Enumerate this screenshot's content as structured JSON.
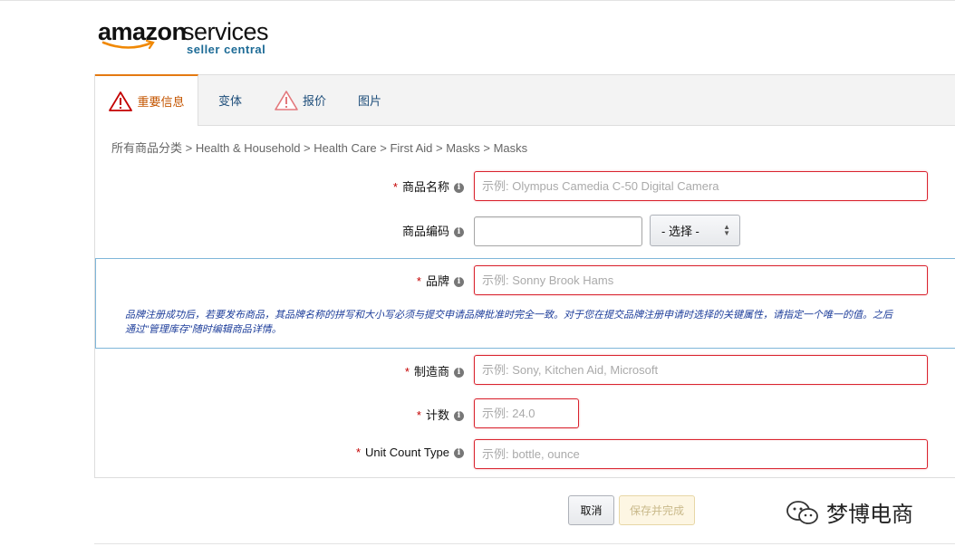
{
  "logo": {
    "amazon": "amazon",
    "services": "services",
    "sub": "seller central"
  },
  "tabs": [
    {
      "label": "重要信息",
      "warning": true,
      "active": true
    },
    {
      "label": "变体",
      "warning": false,
      "active": false
    },
    {
      "label": "报价",
      "warning": true,
      "active": false
    },
    {
      "label": "图片",
      "warning": false,
      "active": false
    }
  ],
  "breadcrumb": "所有商品分类 > Health & Household > Health Care > First Aid > Masks > Masks",
  "fields": {
    "product_name": {
      "label": "商品名称",
      "required": true,
      "placeholder": "示例: Olympus Camedia C-50 Digital Camera"
    },
    "product_id": {
      "label": "商品编码",
      "required": false,
      "placeholder": "",
      "select_label": "- 选择 -"
    },
    "brand": {
      "label": "品牌",
      "required": true,
      "placeholder": "示例: Sonny Brook Hams"
    },
    "manufacturer": {
      "label": "制造商",
      "required": true,
      "placeholder": "示例: Sony, Kitchen Aid, Microsoft"
    },
    "count": {
      "label": "计数",
      "required": true,
      "placeholder": "示例: 24.0"
    },
    "unit_count_type": {
      "label": "Unit Count Type",
      "required": true,
      "placeholder": "示例: bottle, ounce"
    }
  },
  "brand_note": {
    "line1": "品牌注册成功后，若要发布商品，其品牌名称的拼写和大小写必须与提交申请品牌批准时完全一致。对于您在提交品牌注册申请时选择的关键属性，请指定一个唯一的值。之后",
    "line2": "通过\"管理库存\"随时编辑商品详情。"
  },
  "required_mark": "*",
  "info_glyph": "i",
  "buttons": {
    "cancel": "取消",
    "save": "保存并完成"
  },
  "watermark": "梦博电商",
  "colors": {
    "accent": "#e47911",
    "error_border": "#d9232e",
    "link": "#1d4d7a"
  }
}
